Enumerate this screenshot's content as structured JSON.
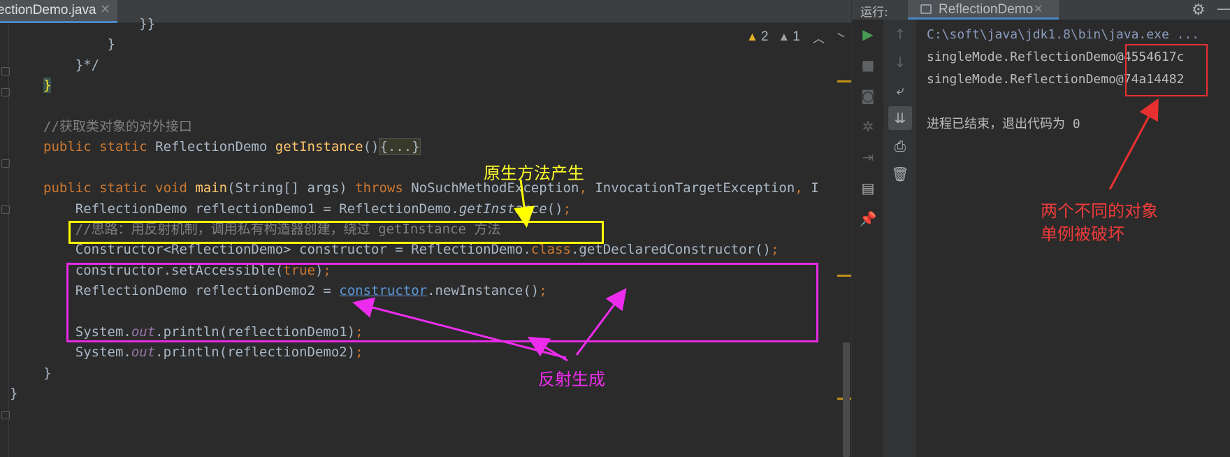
{
  "editor": {
    "tab_title": "ectionDemo.java",
    "tab_close": "✕",
    "inspections": {
      "warnings": "2",
      "weak_warnings": "1",
      "up_arrow": "︿",
      "down_arrow": "﹀"
    },
    "code": [
      {
        "segments": [
          {
            "t": "            }}",
            "c": ""
          }
        ]
      },
      {
        "segments": [
          {
            "t": "        }",
            "c": ""
          }
        ]
      },
      {
        "segments": [
          {
            "t": "    }*/",
            "c": ""
          }
        ]
      },
      {
        "segments": [
          {
            "t": "}",
            "c": "brace-hl"
          }
        ]
      },
      {
        "segments": [
          {
            "t": "",
            "c": ""
          }
        ]
      },
      {
        "segments": [
          {
            "t": "//获取类对象的对外接口",
            "c": "cm"
          }
        ]
      },
      {
        "segments": [
          {
            "t": "public static ",
            "c": "kw"
          },
          {
            "t": "ReflectionDemo ",
            "c": ""
          },
          {
            "t": "getInstance",
            "c": "fn"
          },
          {
            "t": "()",
            "c": ""
          },
          {
            "t": "{...}",
            "c": "fold-hl"
          }
        ]
      },
      {
        "segments": [
          {
            "t": "",
            "c": ""
          }
        ]
      },
      {
        "segments": [
          {
            "t": "public static void ",
            "c": "kw"
          },
          {
            "t": "main",
            "c": "fn"
          },
          {
            "t": "(String[] args) ",
            "c": ""
          },
          {
            "t": "throws ",
            "c": "kw"
          },
          {
            "t": "NoSuchMethodException",
            "c": ""
          },
          {
            "t": ", ",
            "c": "kw"
          },
          {
            "t": "InvocationTargetException",
            "c": ""
          },
          {
            "t": ", ",
            "c": "kw"
          },
          {
            "t": "I",
            "c": ""
          }
        ]
      },
      {
        "segments": [
          {
            "t": "    ReflectionDemo reflectionDemo1 = ReflectionDemo.",
            "c": ""
          },
          {
            "t": "getInstance",
            "c": "it"
          },
          {
            "t": "()",
            "c": ""
          },
          {
            "t": ";",
            "c": "kw"
          }
        ]
      },
      {
        "segments": [
          {
            "t": "    //思路：用反射机制，调用私有构造器创建，绕过 getInstance 方法",
            "c": "cm"
          }
        ]
      },
      {
        "segments": [
          {
            "t": "    Constructor<ReflectionDemo> constructor = ReflectionDemo.",
            "c": ""
          },
          {
            "t": "class",
            "c": "kw"
          },
          {
            "t": ".getDeclaredConstructor()",
            "c": ""
          },
          {
            "t": ";",
            "c": "kw"
          }
        ]
      },
      {
        "segments": [
          {
            "t": "    constructor.setAccessible(",
            "c": ""
          },
          {
            "t": "true",
            "c": "kw"
          },
          {
            "t": ")",
            "c": ""
          },
          {
            "t": ";",
            "c": "kw"
          }
        ]
      },
      {
        "segments": [
          {
            "t": "    ReflectionDemo reflectionDemo2 = ",
            "c": ""
          },
          {
            "t": "constructor",
            "c": "ul"
          },
          {
            "t": ".newInstance()",
            "c": ""
          },
          {
            "t": ";",
            "c": "kw"
          }
        ]
      },
      {
        "segments": [
          {
            "t": "",
            "c": ""
          }
        ]
      },
      {
        "segments": [
          {
            "t": "    System.",
            "c": ""
          },
          {
            "t": "out",
            "c": "st"
          },
          {
            "t": ".println(reflectionDemo1)",
            "c": ""
          },
          {
            "t": ";",
            "c": "kw"
          }
        ]
      },
      {
        "segments": [
          {
            "t": "    System.",
            "c": ""
          },
          {
            "t": "out",
            "c": "st"
          },
          {
            "t": ".println(reflectionDemo2)",
            "c": ""
          },
          {
            "t": ";",
            "c": "kw"
          }
        ]
      },
      {
        "segments": [
          {
            "t": "}",
            "c": ""
          }
        ]
      },
      {
        "segments": [
          {
            "t": "}",
            "c": ""
          }
        ]
      }
    ]
  },
  "annotations": {
    "native_method": "原生方法产生",
    "reflection": "反射生成",
    "different_objects_line1": "两个不同的对象",
    "different_objects_line2": "单例被破坏",
    "colors": {
      "yellow": "#ffff00",
      "magenta": "#e62be6",
      "red": "#e83030"
    }
  },
  "run_panel": {
    "label": "运行:",
    "tab_title": "ReflectionDemo",
    "tab_close": "✕",
    "settings_icon": "⚙",
    "minimize_icon": "—",
    "toolbar1": [
      {
        "name": "run-icon",
        "glyph": "▶",
        "style": "play"
      },
      {
        "name": "stop-icon",
        "glyph": "■",
        "style": "dim"
      },
      {
        "name": "camera-icon",
        "glyph": "◙",
        "style": "dim"
      },
      {
        "name": "debug-icon",
        "glyph": "✲",
        "style": "dim"
      },
      {
        "name": "exit-icon",
        "glyph": "⇥",
        "style": "dim"
      },
      {
        "name": "layout-icon",
        "glyph": "▤",
        "style": ""
      },
      {
        "name": "pin-icon",
        "glyph": "📌",
        "style": "dim"
      }
    ],
    "toolbar2": [
      {
        "name": "up-icon",
        "glyph": "↑",
        "style": "dim"
      },
      {
        "name": "down-icon",
        "glyph": "↓",
        "style": "dim"
      },
      {
        "name": "soft-wrap-icon",
        "glyph": "⤶",
        "style": ""
      },
      {
        "name": "scroll-to-end-icon",
        "glyph": "⇊",
        "style": "active"
      },
      {
        "name": "print-icon",
        "glyph": "⎙",
        "style": ""
      },
      {
        "name": "trash-icon",
        "glyph": "🗑",
        "style": ""
      }
    ],
    "console": [
      {
        "text": "C:\\soft\\java\\jdk1.8\\bin\\java.exe ...",
        "style": "cmd"
      },
      {
        "text": "singleMode.ReflectionDemo@4554617c",
        "style": ""
      },
      {
        "text": "singleMode.ReflectionDemo@74a14482",
        "style": ""
      },
      {
        "text": "",
        "style": ""
      },
      {
        "text": "进程已结束，退出代码为 0",
        "style": ""
      }
    ]
  }
}
